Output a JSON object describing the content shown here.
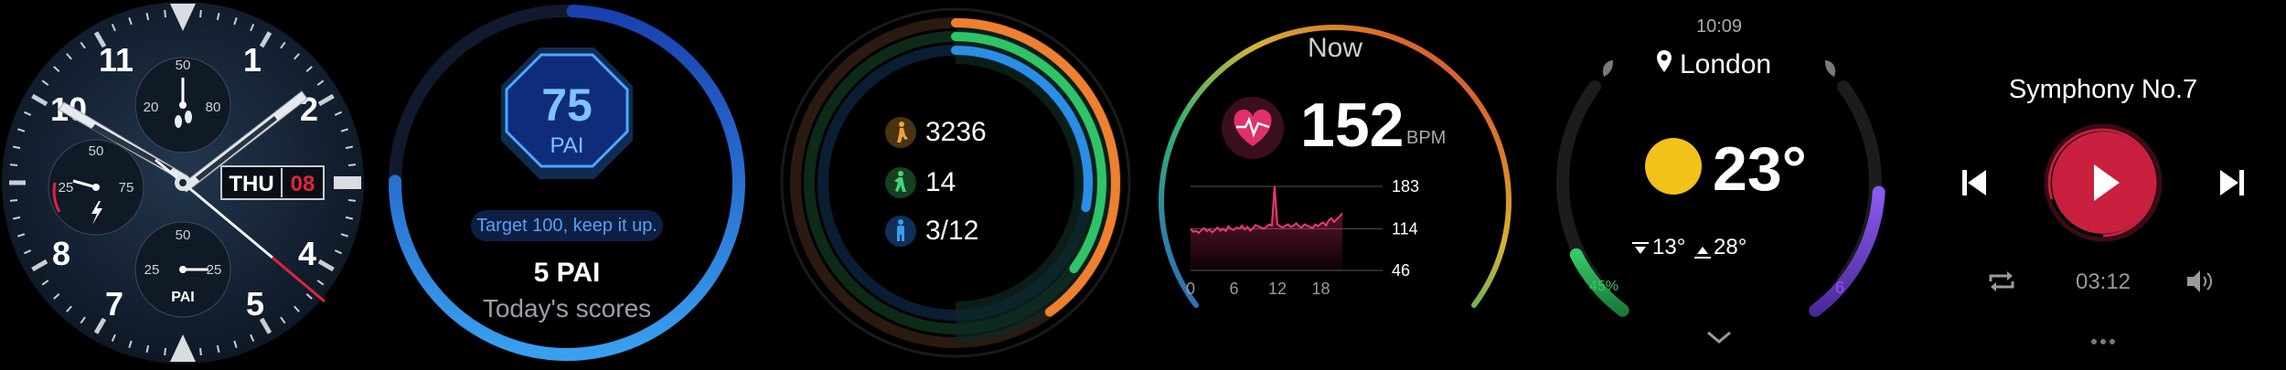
{
  "watch_face": {
    "numerals": [
      "11",
      "1",
      "2",
      "4",
      "5",
      "7",
      "8",
      "10"
    ],
    "date_day": "THU",
    "date_num": "08",
    "top_sub": {
      "labels": [
        "50",
        "20",
        "80"
      ]
    },
    "left_sub": {
      "labels": [
        "50",
        "25",
        "75"
      ]
    },
    "bottom_sub": {
      "labels": [
        "50",
        "25",
        "25"
      ],
      "caption": "PAI"
    },
    "accent": "#e0243c"
  },
  "pai": {
    "value": "75",
    "unit": "PAI",
    "target_text": "Target 100, keep it up.",
    "score": "5 PAI",
    "caption": "Today's scores",
    "progress": 0.75,
    "accent": "#2f7be8"
  },
  "activity": {
    "steps": "3236",
    "calories": "14",
    "stand": "3/12",
    "rings": {
      "move": 0.4,
      "exercise": 0.35,
      "stand": 0.28
    },
    "colors": {
      "move": "#f08030",
      "exercise": "#2ec467",
      "stand": "#2a8ee6"
    }
  },
  "heart": {
    "title": "Now",
    "bpm": "152",
    "unit": "BPM",
    "y_labels": [
      "183",
      "114",
      "46"
    ],
    "x_labels": [
      "0",
      "6",
      "12",
      "18"
    ],
    "accent": "#e0306a",
    "series": [
      114,
      109,
      111,
      107,
      112,
      115,
      110,
      113,
      108,
      112,
      116,
      111,
      114,
      110,
      118,
      113,
      112,
      116,
      114,
      119,
      113,
      117,
      111,
      115,
      120,
      118,
      116,
      114,
      117,
      121,
      119,
      183,
      122,
      118,
      116,
      119,
      121,
      117,
      119,
      123,
      118,
      116,
      121,
      119,
      117,
      115,
      121,
      118,
      122,
      124,
      119,
      128,
      131,
      125,
      130,
      134,
      139
    ]
  },
  "weather": {
    "time": "10:09",
    "city": "London",
    "temp": "23°",
    "low": "13°",
    "high": "28°",
    "humidity_label": "45%",
    "humidity": 0.45,
    "uv_label": "6",
    "uv": 0.55
  },
  "music": {
    "title": "Symphony No.7",
    "time": "03:12",
    "accent": "#c8203e"
  }
}
